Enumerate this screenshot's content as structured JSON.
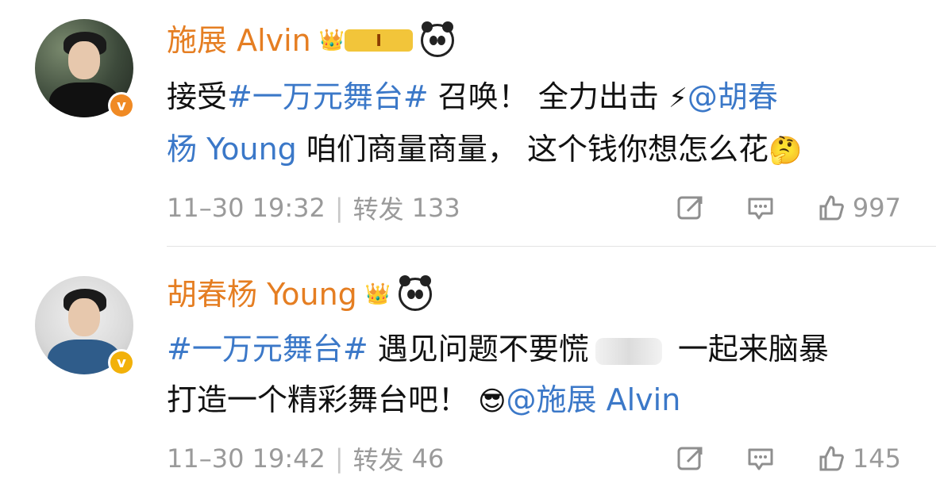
{
  "posts": [
    {
      "user": {
        "name": "施展 Alvin",
        "badge": {
          "crown": "👑",
          "level": "I"
        },
        "verified_icon": "v",
        "verified_color": "#f08a24"
      },
      "text": {
        "line1": [
          "接受",
          "#一万元舞台#",
          " 召唤！ 全力出击 ",
          "⚡",
          "@胡春"
        ],
        "line2": [
          "杨 Young",
          " 咱们商量商量， 这个钱你想怎么花",
          "🤔"
        ]
      },
      "meta": {
        "time": "11–30 19:32",
        "repost_label": "转发",
        "repost_count": "133",
        "like_count": "997"
      }
    },
    {
      "user": {
        "name": "胡春杨 Young",
        "badge": {
          "crown": "👑"
        },
        "verified_icon": "v",
        "verified_color": "#f2b10a"
      },
      "text": {
        "line1": [
          "#一万元舞台#",
          " 遇见问题不要慌",
          "",
          " 一起来脑暴"
        ],
        "line2": [
          "打造一个精彩舞台吧！ ",
          "😎",
          "@施展 Alvin"
        ]
      },
      "meta": {
        "time": "11–30 19:42",
        "repost_label": "转发",
        "repost_count": "46",
        "like_count": "145"
      }
    }
  ],
  "ui": {
    "accent_name": "#e57e22",
    "link_blue": "#3b78c8",
    "icon_repost": "repost-icon",
    "icon_comment": "comment-icon",
    "icon_like": "thumbs-up-icon"
  }
}
